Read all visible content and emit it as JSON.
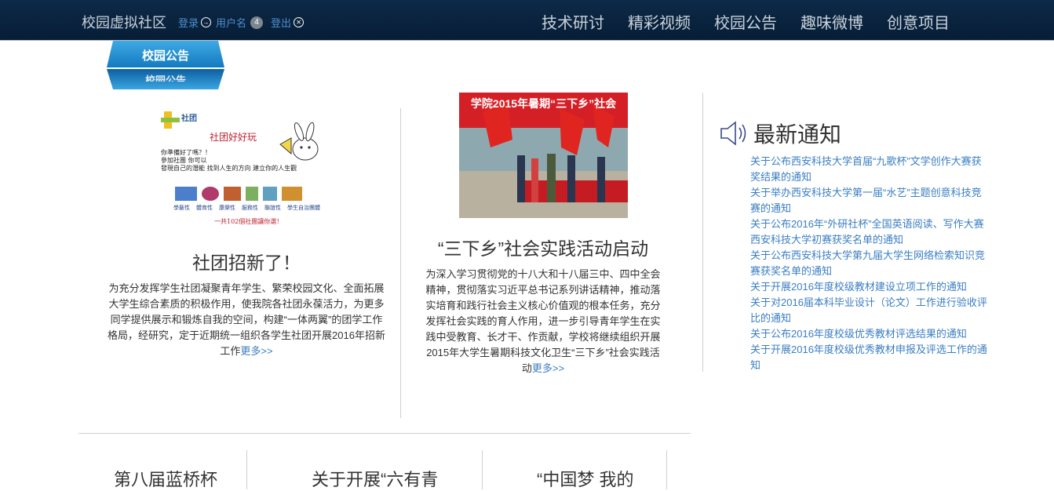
{
  "header": {
    "site_title": "校园虚拟社区",
    "login": "登录",
    "username": "用户名",
    "badge_count": "4",
    "logout": "登出",
    "nav": [
      "技术研讨",
      "精彩视频",
      "校园公告",
      "趣味微博",
      "创意项目"
    ]
  },
  "section": {
    "ribbon": "校园公告"
  },
  "poster": {
    "tag": "社团",
    "headline": "社团好好玩",
    "lines": [
      "你準備好了嗎？！",
      "參加社團 你可以",
      "發現自己的潛能 找到人生的方向 建立你的人生觀"
    ],
    "clubs": [
      "學藝性",
      "體育性",
      "康樂性",
      "服務性",
      "聯誼性",
      "學生自治團體"
    ],
    "footer": "一共102個社團讓你選！"
  },
  "articles": [
    {
      "title": "社团招新了！",
      "body": "为充分发挥学生社团凝聚青年学生、繁荣校园文化、全面拓展大学生综合素质的积极作用，使我院各社团永葆活力，为更多同学提供展示和锻炼自我的空间，构建“一体两翼”的团学工作格局，经研究，定于近期统一组织各学生社团开展2016年招新工作",
      "more": "更多>>"
    },
    {
      "title": "“三下乡”社会实践活动启动",
      "body": "为深入学习贯彻党的十八大和十八届三中、四中全会精神，贯彻落实习近平总书记系列讲话精神，推动落实培育和践行社会主义核心价值观的根本任务，充分发挥社会实践的育人作用，进一步引导青年学生在实践中受教育、长才干、作贡献，学校将继续组织开展2015年大学生暑期科技文化卫生“三下乡”社会实践活动",
      "more": "更多>>",
      "banner_text": "学院2015年暑期“三下乡”社会"
    }
  ],
  "notice": {
    "title": "最新通知",
    "items": [
      "关于公布西安科技大学首届“九歌杯”文学创作大赛获奖结果的通知",
      "关于举办西安科技大学第一届“水艺”主题创意科技竞赛的通知",
      "关于公布2016年“外研社杯”全国英语阅读、写作大赛西安科技大学初赛获奖名单的通知",
      "关于公布西安科技大学第九届大学生网络检索知识竞赛获奖名单的通知",
      "关于开展2016年度校级教材建设立项工作的通知",
      "关于对2016届本科毕业设计（论文）工作进行验收评比的通知",
      "关于公布2016年度校级优秀教材评选结果的通知",
      "关于开展2016年度校级优秀教材申报及评选工作的通知"
    ]
  },
  "bottom": [
    "第八届蓝桥杯",
    "关于开展“六有青",
    "“中国梦 我的"
  ],
  "colors": {
    "topbar": "#0b2542",
    "link": "#3a7ec2",
    "ribbon": "#1f8fd0"
  }
}
